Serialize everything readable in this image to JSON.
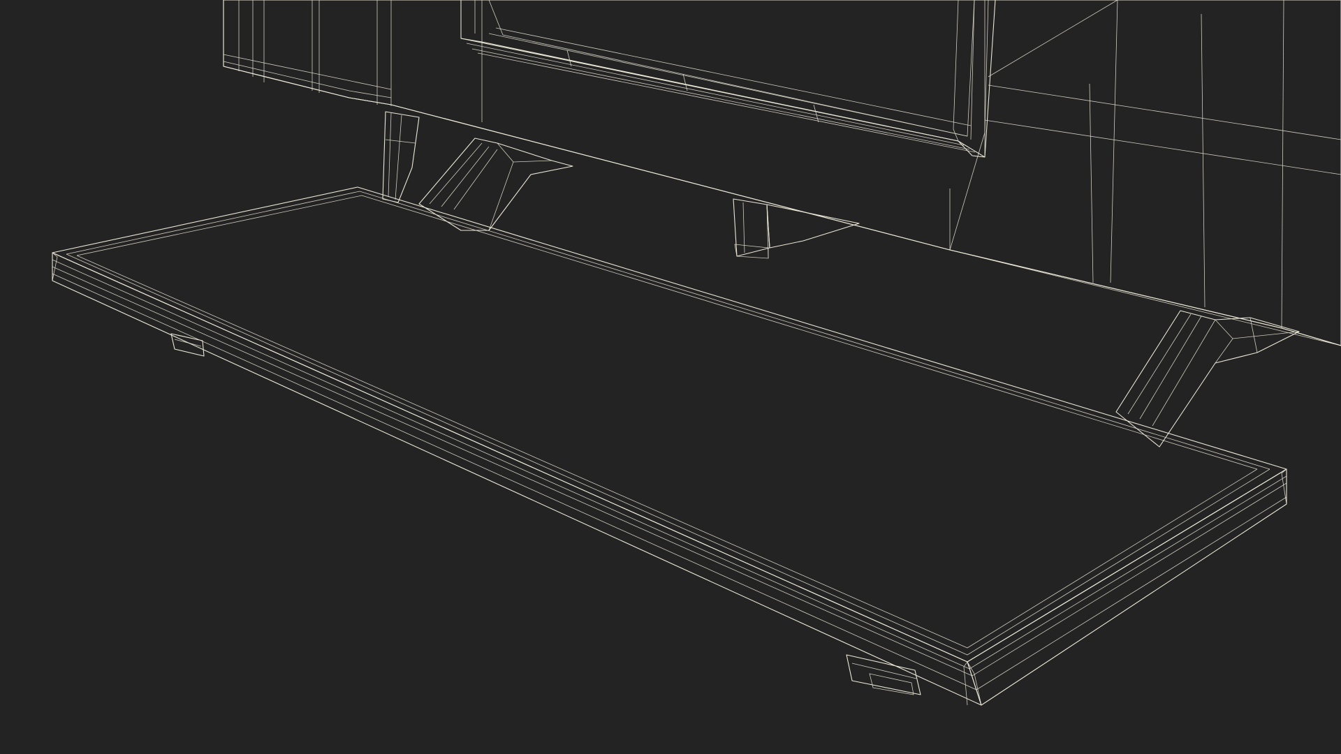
{
  "scene": {
    "subject": "wireframe-3d-render",
    "colors": {
      "background": "#232323",
      "surface_light": "#8a8a79",
      "surface_mid": "#727261",
      "surface_dark": "#5e5f50",
      "edge": "#4e4f42",
      "wireframe": "#eae7d6"
    }
  }
}
